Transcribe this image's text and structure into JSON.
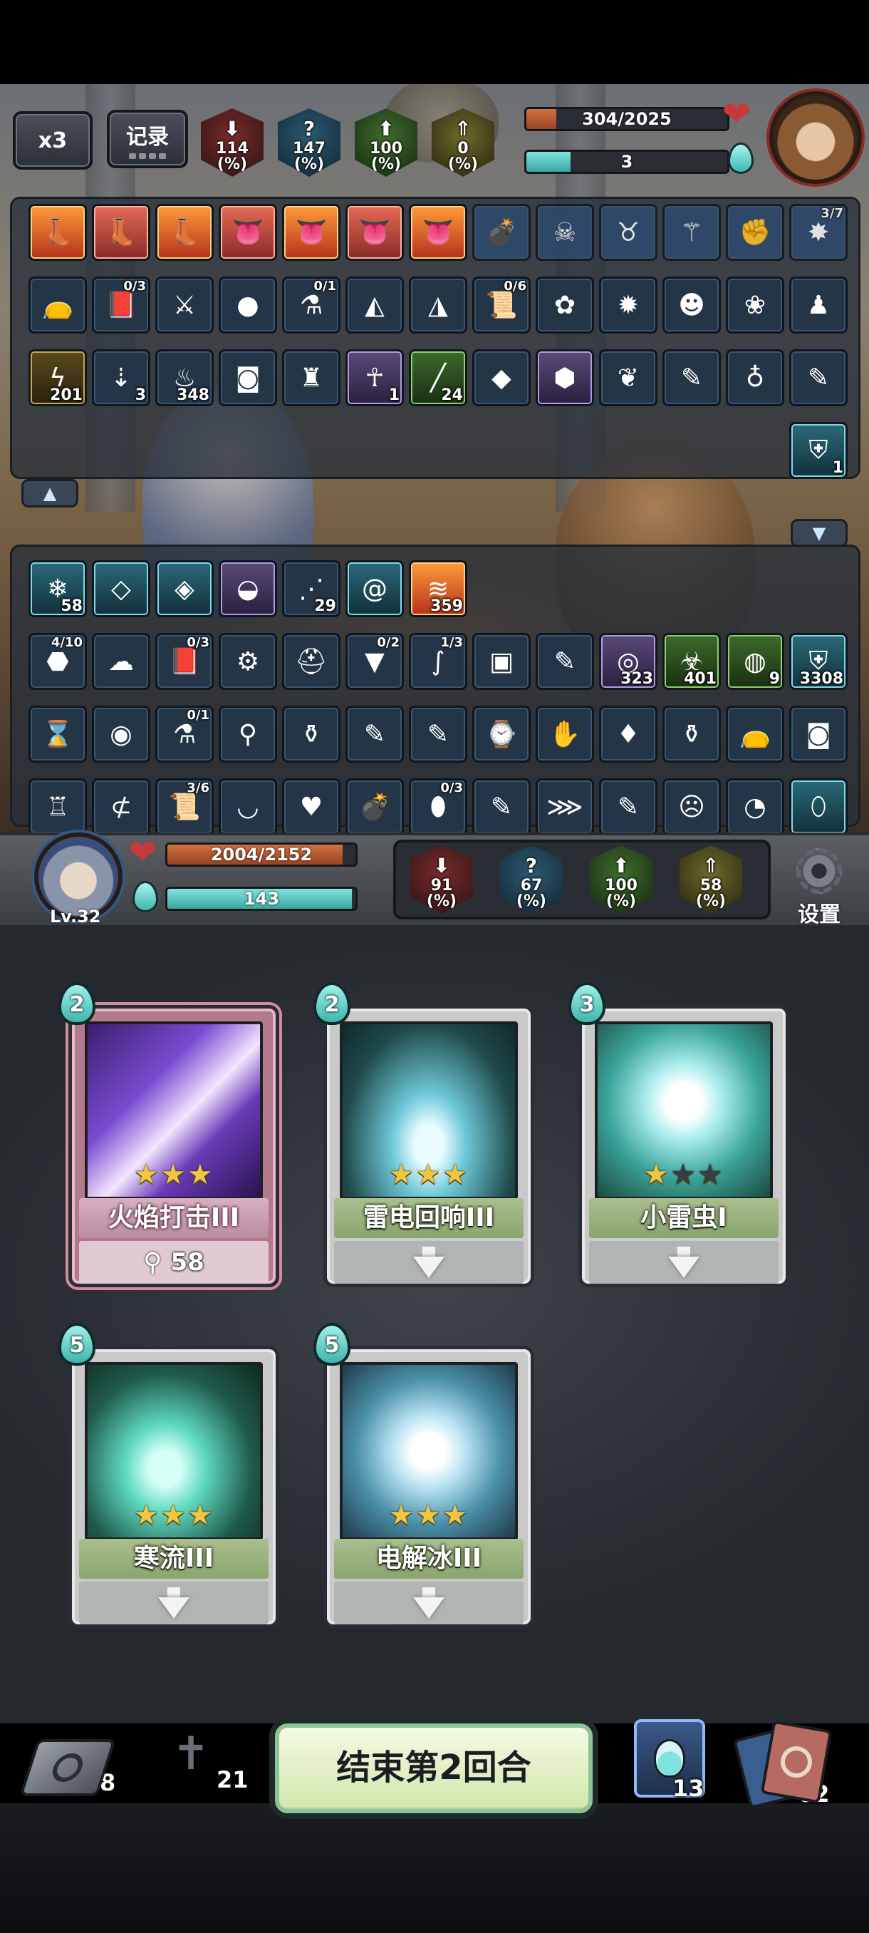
{
  "hud": {
    "speed_label": "x3",
    "log_label": "记录",
    "enemy_stats": [
      {
        "value": "114",
        "unit": "(%)",
        "kind": "atk"
      },
      {
        "value": "147",
        "unit": "(%)",
        "kind": "crit"
      },
      {
        "value": "100",
        "unit": "(%)",
        "kind": "def"
      },
      {
        "value": "0",
        "unit": "(%)",
        "kind": "spd"
      }
    ],
    "enemy_hp_text": "304/2025",
    "enemy_hp_fraction": 0.15,
    "enemy_energy": "3",
    "enemy_energy_fraction": 0.22
  },
  "enemy_panel": {
    "row1": [
      {
        "icon": "boot-icon",
        "style": "hot"
      },
      {
        "icon": "boot-icon",
        "style": "rose"
      },
      {
        "icon": "boot-icon",
        "style": "hot"
      },
      {
        "icon": "tongue-icon",
        "style": "rose"
      },
      {
        "icon": "tongue-icon",
        "style": "hot"
      },
      {
        "icon": "tongue-icon",
        "style": "rose"
      },
      {
        "icon": "tongue-icon",
        "style": "hot"
      },
      {
        "icon": "bomb-icon",
        "style": "ghost"
      },
      {
        "icon": "skull-icon",
        "style": "ghost"
      },
      {
        "icon": "beast-icon",
        "style": "ghost"
      },
      {
        "icon": "staff-icon",
        "style": "ghost"
      },
      {
        "icon": "fist-icon",
        "style": "ghost"
      },
      {
        "icon": "burst-icon",
        "style": "ghost",
        "frac": "3/7"
      }
    ],
    "row2": [
      {
        "icon": "pouch-icon"
      },
      {
        "icon": "book-icon",
        "frac": "0/3"
      },
      {
        "icon": "sword-icon"
      },
      {
        "icon": "orb-icon"
      },
      {
        "icon": "flask-icon",
        "frac": "0/1"
      },
      {
        "icon": "rice-ball-icon"
      },
      {
        "icon": "hood-icon"
      },
      {
        "icon": "scroll-icon",
        "frac": "0/6"
      },
      {
        "icon": "plant-icon"
      },
      {
        "icon": "spiked-ball-icon"
      },
      {
        "icon": "mask-icon"
      },
      {
        "icon": "flower-icon"
      },
      {
        "icon": "doll-icon"
      }
    ],
    "row3": [
      {
        "icon": "lightning-icon",
        "style": "gold",
        "count": "201"
      },
      {
        "icon": "down-arrow-icon",
        "count": "3"
      },
      {
        "icon": "flame-icon",
        "count": "348"
      },
      {
        "icon": "barrel-icon"
      },
      {
        "icon": "golem-icon"
      },
      {
        "icon": "summon-icon",
        "style": "purple",
        "count": "1"
      },
      {
        "icon": "blade-icon",
        "style": "green",
        "count": "24"
      },
      {
        "icon": "crystal-icon"
      },
      {
        "icon": "rune-icon",
        "style": "purple"
      },
      {
        "icon": "phoenix-icon"
      },
      {
        "icon": "feather-icon"
      },
      {
        "icon": "gourd-icon"
      },
      {
        "icon": "feather-blue-icon"
      }
    ],
    "row4": [
      {
        "icon": "shield-icon",
        "style": "teal",
        "count": "1"
      }
    ]
  },
  "player_panel": {
    "row1": [
      {
        "icon": "ice-buff-icon",
        "style": "teal",
        "count": "58"
      },
      {
        "icon": "ice-crystal-icon",
        "style": "teal"
      },
      {
        "icon": "frost-shield-icon",
        "style": "teal"
      },
      {
        "icon": "shell-icon",
        "style": "purple"
      },
      {
        "icon": "claw-icon",
        "count": "29"
      },
      {
        "icon": "vortex-icon",
        "style": "teal"
      },
      {
        "icon": "heat-icon",
        "style": "hot",
        "count": "359"
      }
    ],
    "row2": [
      {
        "icon": "turtle-icon",
        "frac": "4/10"
      },
      {
        "icon": "ghost-icon"
      },
      {
        "icon": "book-icon",
        "frac": "0/3"
      },
      {
        "icon": "gear-orb-icon"
      },
      {
        "icon": "helmet-icon"
      },
      {
        "icon": "armor-icon",
        "frac": "0/2"
      },
      {
        "icon": "tentacle-icon",
        "frac": "1/3"
      },
      {
        "icon": "tome-icon"
      },
      {
        "icon": "feather-icon"
      },
      {
        "icon": "spiral-icon",
        "style": "purple",
        "count": "323"
      },
      {
        "icon": "poison-icon",
        "style": "green",
        "count": "401"
      },
      {
        "icon": "slime-icon",
        "style": "green",
        "count": "9"
      },
      {
        "icon": "shield-icon",
        "style": "teal",
        "count": "3308"
      }
    ],
    "row3": [
      {
        "icon": "hourglass-icon"
      },
      {
        "icon": "fire-orb-icon"
      },
      {
        "icon": "flask-icon",
        "frac": "0/1"
      },
      {
        "icon": "mace-icon"
      },
      {
        "icon": "potion-icon"
      },
      {
        "icon": "feather-red-icon"
      },
      {
        "icon": "feather-gold-icon"
      },
      {
        "icon": "watch-icon"
      },
      {
        "icon": "glove-icon"
      },
      {
        "icon": "bottle-icon"
      },
      {
        "icon": "vase-icon"
      },
      {
        "icon": "pouch-icon"
      },
      {
        "icon": "barrel-icon"
      }
    ],
    "row4": [
      {
        "icon": "robot-icon"
      },
      {
        "icon": "vial-icon"
      },
      {
        "icon": "scroll-icon",
        "frac": "3/6"
      },
      {
        "icon": "bowl-icon"
      },
      {
        "icon": "fire-fruit-icon"
      },
      {
        "icon": "bomb-icon"
      },
      {
        "icon": "egg-icon",
        "frac": "0/3"
      },
      {
        "icon": "feather-icon"
      },
      {
        "icon": "wing-icon"
      },
      {
        "icon": "feather-blue-icon"
      },
      {
        "icon": "helmet-skull-icon"
      },
      {
        "icon": "shell-pouch-icon"
      },
      {
        "icon": "crystal-egg-icon",
        "style": "teal"
      }
    ]
  },
  "player": {
    "level": "Lv.32",
    "hp_text": "2004/2152",
    "hp_fraction": 0.93,
    "energy": "143",
    "energy_fraction": 0.98,
    "stats": [
      {
        "value": "91",
        "unit": "(%)",
        "kind": "atk"
      },
      {
        "value": "67",
        "unit": "(%)",
        "kind": "crit"
      },
      {
        "value": "100",
        "unit": "(%)",
        "kind": "def"
      },
      {
        "value": "58",
        "unit": "(%)",
        "kind": "spd"
      }
    ],
    "settings_label": "设置"
  },
  "hand": [
    {
      "cost": "2",
      "name": "火焰打击III",
      "stars": 3,
      "selected": true,
      "footer_value": "58",
      "art": "purple"
    },
    {
      "cost": "2",
      "name": "雷电回响III",
      "stars": 3,
      "selected": false,
      "art": "lightning"
    },
    {
      "cost": "3",
      "name": "小雷虫I",
      "stars": 1,
      "selected": false,
      "art": "spirit"
    },
    {
      "cost": "5",
      "name": "寒流III",
      "stars": 3,
      "selected": false,
      "art": "frost"
    },
    {
      "cost": "5",
      "name": "电解冰III",
      "stars": 3,
      "selected": false,
      "art": "ice"
    }
  ],
  "bottom": {
    "exhaust_count": "8",
    "grave_count": "21",
    "end_turn_label": "结束第2回合",
    "potion_count": "13",
    "draw_count": "62"
  }
}
